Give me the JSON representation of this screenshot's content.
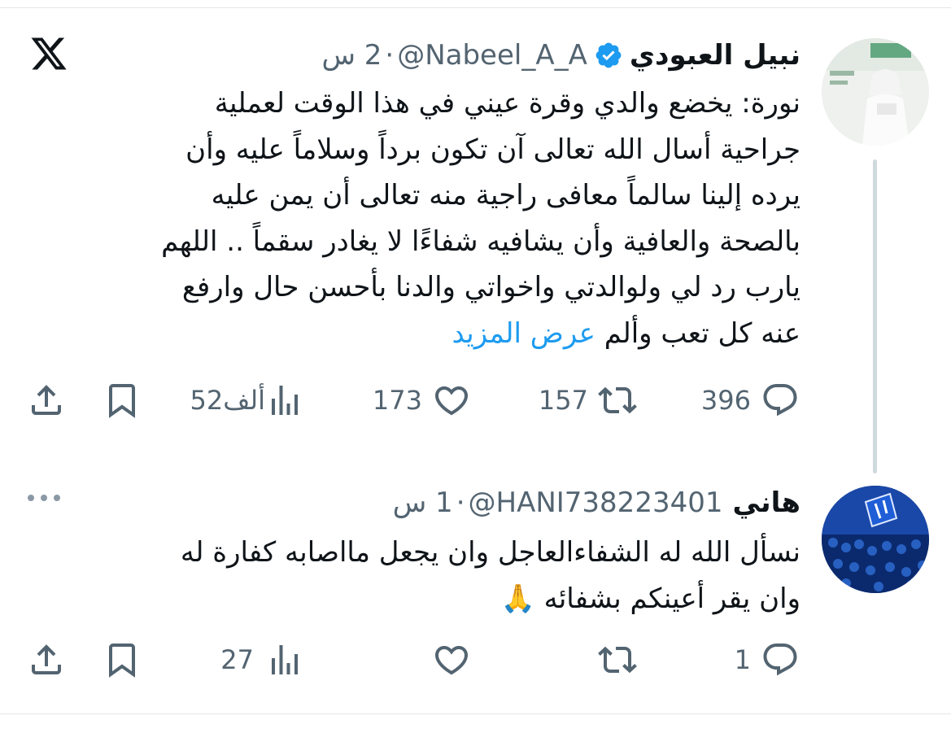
{
  "tweet": {
    "name": "نبيل العبودي",
    "handle": "@Nabeel_A_A",
    "separator": "·",
    "time": "2 س",
    "text_lines": [
      "نورة: يخضع والدي وقرة عيني في هذا الوقت لعملية",
      "جراحية أسال الله تعالى آن تكون برداً وسلاماً عليه وأن",
      "يرده إلينا سالماً معافى راجية منه تعالى أن يمن عليه",
      "بالصحة والعافية وأن يشافيه شفاءًا لا يغادر سقماً .. اللهم",
      "يارب رد لي ولوالدتي واخواتي والدنا بأحسن حال وارفع"
    ],
    "last_line": "عنه كل تعب وألم",
    "show_more": "عرض المزيد",
    "replies": "396",
    "retweets": "157",
    "likes": "173",
    "views": "52ألف"
  },
  "reply": {
    "name": "هاني",
    "handle": "@HANI738223401",
    "separator": "·",
    "time": "1 س",
    "text_lines": [
      "نسأل الله له الشفاءالعاجل وان يجعل مااصابه كفارة له",
      "وان يقر أعينكم بشفائه 🙏"
    ],
    "replies": "1",
    "views": "27"
  },
  "icons": {
    "logo": "x-logo-icon",
    "verified": "verified-badge-icon",
    "more": "more-dots-icon",
    "reply": "reply-bubble-icon",
    "retweet": "retweet-icon",
    "like": "heart-icon",
    "views": "views-bar-chart-icon",
    "bookmark": "bookmark-icon",
    "share": "share-upload-icon"
  },
  "colors": {
    "accent": "#1d9bf0",
    "secondary": "#536471",
    "text": "#0f1419"
  }
}
